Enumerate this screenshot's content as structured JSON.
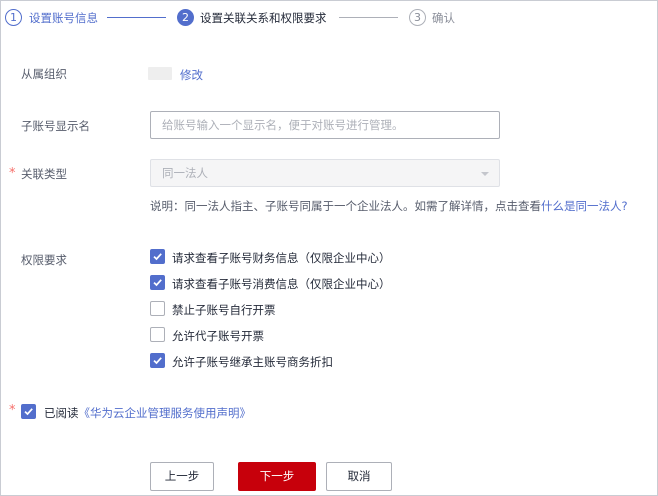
{
  "stepper": {
    "steps": [
      {
        "number": "1",
        "label": "设置账号信息",
        "state": "done"
      },
      {
        "number": "2",
        "label": "设置关联关系和权限要求",
        "state": "active"
      },
      {
        "number": "3",
        "label": "确认",
        "state": "pending"
      }
    ]
  },
  "form": {
    "org": {
      "label": "从属组织",
      "edit_link": "修改"
    },
    "display_name": {
      "label": "子账号显示名",
      "placeholder": "给账号输入一个显示名，便于对账号进行管理。",
      "value": ""
    },
    "relation_type": {
      "label": "关联类型",
      "required_mark": "*",
      "selected": "同一法人",
      "disabled": true
    },
    "hint": {
      "text": "说明：同一法人指主、子账号同属于一个企业法人。如需了解详情，点击查看",
      "link": "什么是同一法人?"
    },
    "permissions": {
      "label": "权限要求",
      "options": [
        {
          "label": "请求查看子账号财务信息（仅限企业中心）",
          "checked": true
        },
        {
          "label": "请求查看子账号消费信息（仅限企业中心）",
          "checked": true
        },
        {
          "label": "禁止子账号自行开票",
          "checked": false
        },
        {
          "label": "允许代子账号开票",
          "checked": false
        },
        {
          "label": "允许子账号继承主账号商务折扣",
          "checked": true
        }
      ]
    },
    "agreement": {
      "required_mark": "*",
      "checked": true,
      "prefix": "已阅读",
      "link": "《华为云企业管理服务使用声明》"
    }
  },
  "footer": {
    "prev_label": "上一步",
    "next_label": "下一步",
    "cancel_label": "取消"
  },
  "colors": {
    "accent": "#526ecc",
    "primary_button": "#c7000b",
    "required": "#f66f6a"
  }
}
